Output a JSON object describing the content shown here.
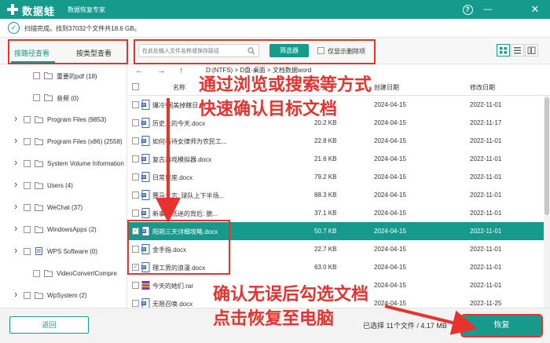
{
  "app": {
    "name": "数据蛙",
    "subtitle": "数据恢复专家"
  },
  "scan": {
    "status": "扫描完成。找到37032个文件共18.6 GB。"
  },
  "toolbar": {
    "tab_path": "按路径查看",
    "tab_type": "按类型查看",
    "search_placeholder": "在此处输入文件名称或保存路径",
    "filter_label": "筛选器",
    "deleted_only_label": "仅显示删除项"
  },
  "tree": [
    {
      "label": "重要的pdf (18)",
      "arrow": false,
      "indent": 1
    },
    {
      "label": "音频 (0)",
      "arrow": false,
      "indent": 1
    },
    {
      "label": "Program Files (9853)",
      "arrow": true,
      "indent": 0
    },
    {
      "label": "Program Files (x86) (2558)",
      "arrow": true,
      "indent": 0
    },
    {
      "label": "System Volume Information",
      "arrow": true,
      "indent": 0
    },
    {
      "label": "Users (4)",
      "arrow": true,
      "indent": 0
    },
    {
      "label": "WeChat (37)",
      "arrow": true,
      "indent": 0
    },
    {
      "label": "WindowsApps (2)",
      "arrow": true,
      "indent": 0
    },
    {
      "label": "WPS Software (0)",
      "arrow": true,
      "indent": 0,
      "doc": true
    },
    {
      "label": "VideoConvertCompre",
      "arrow": false,
      "indent": 1
    },
    {
      "label": "WpSystem (2)",
      "arrow": true,
      "indent": 0
    }
  ],
  "list": {
    "breadcrumb": "D:(NTFS) > D盘-桌面 > 文档数据word",
    "headers": {
      "name": "名称",
      "size": "大小",
      "created": "创建日期",
      "modified": "修改日期"
    },
    "rows": [
      {
        "name": "爆冷!国美掉瞎日...",
        "size": "",
        "created": "2024-04-15",
        "modified": "2022-11-01",
        "checked": false,
        "selected": false,
        "icon": "doc"
      },
      {
        "name": "历史上的今天.docx",
        "size": "20.2 KB",
        "created": "2024-04-15",
        "modified": "2022-11-17",
        "checked": false,
        "selected": false,
        "icon": "doc"
      },
      {
        "name": "如何看待女律师为农民工...",
        "size": "22.8 KB",
        "created": "2024-04-15",
        "modified": "2022-11-01",
        "checked": false,
        "selected": false,
        "icon": "doc"
      },
      {
        "name": "复古游戏模拟器.docx",
        "size": "21.6 KB",
        "created": "2024-04-15",
        "modified": "2022-11-01",
        "checked": false,
        "selected": false,
        "icon": "doc"
      },
      {
        "name": "日常星座.docx",
        "size": "79.2 KB",
        "created": "2024-04-15",
        "modified": "2022-11-01",
        "checked": false,
        "selected": false,
        "icon": "doc"
      },
      {
        "name": "赛马大志: 球队上下半场...",
        "size": "88.3 KB",
        "created": "2024-04-15",
        "modified": "2022-11-01",
        "checked": false,
        "selected": false,
        "icon": "doc"
      },
      {
        "name": "新事业低迷的背后: 脆...",
        "size": "37.1 KB",
        "created": "2024-04-15",
        "modified": "2022-11-01",
        "checked": false,
        "selected": false,
        "icon": "doc"
      },
      {
        "name": "阳朔三天详细攻略.docx",
        "size": "50.7 KB",
        "created": "2024-04-15",
        "modified": "2022-11-01",
        "checked": true,
        "selected": true,
        "icon": "doc"
      },
      {
        "name": "金手指.docx",
        "size": "22.7 KB",
        "created": "2024-04-15",
        "modified": "2022-11-01",
        "checked": false,
        "selected": false,
        "icon": "doc"
      },
      {
        "name": "理工男的浪漫.docx",
        "size": "63.0 KB",
        "created": "2024-04-15",
        "modified": "2022-11-01",
        "checked": true,
        "selected": false,
        "icon": "doc"
      },
      {
        "name": "今天的她们.rar",
        "size": "",
        "created": "2024-04-15",
        "modified": "2022-11-01",
        "checked": false,
        "selected": false,
        "icon": "rar"
      },
      {
        "name": "无限召唤.docx",
        "size": "",
        "created": "2024-04-15",
        "modified": "2022-11-25",
        "checked": false,
        "selected": false,
        "icon": "doc"
      }
    ]
  },
  "footer": {
    "back_label": "返回",
    "selection_info": "已选择 11个文件 / 4.17 MB",
    "recover_label": "恢复"
  },
  "annotations": {
    "line1": "通过浏览或搜索等方式",
    "line2": "快速确认目标文档",
    "line3": "确认无误后勾选文档",
    "line4": "点击恢复至电脑"
  },
  "colors": {
    "brand": "#159a8c",
    "annotation": "#e8322d"
  }
}
